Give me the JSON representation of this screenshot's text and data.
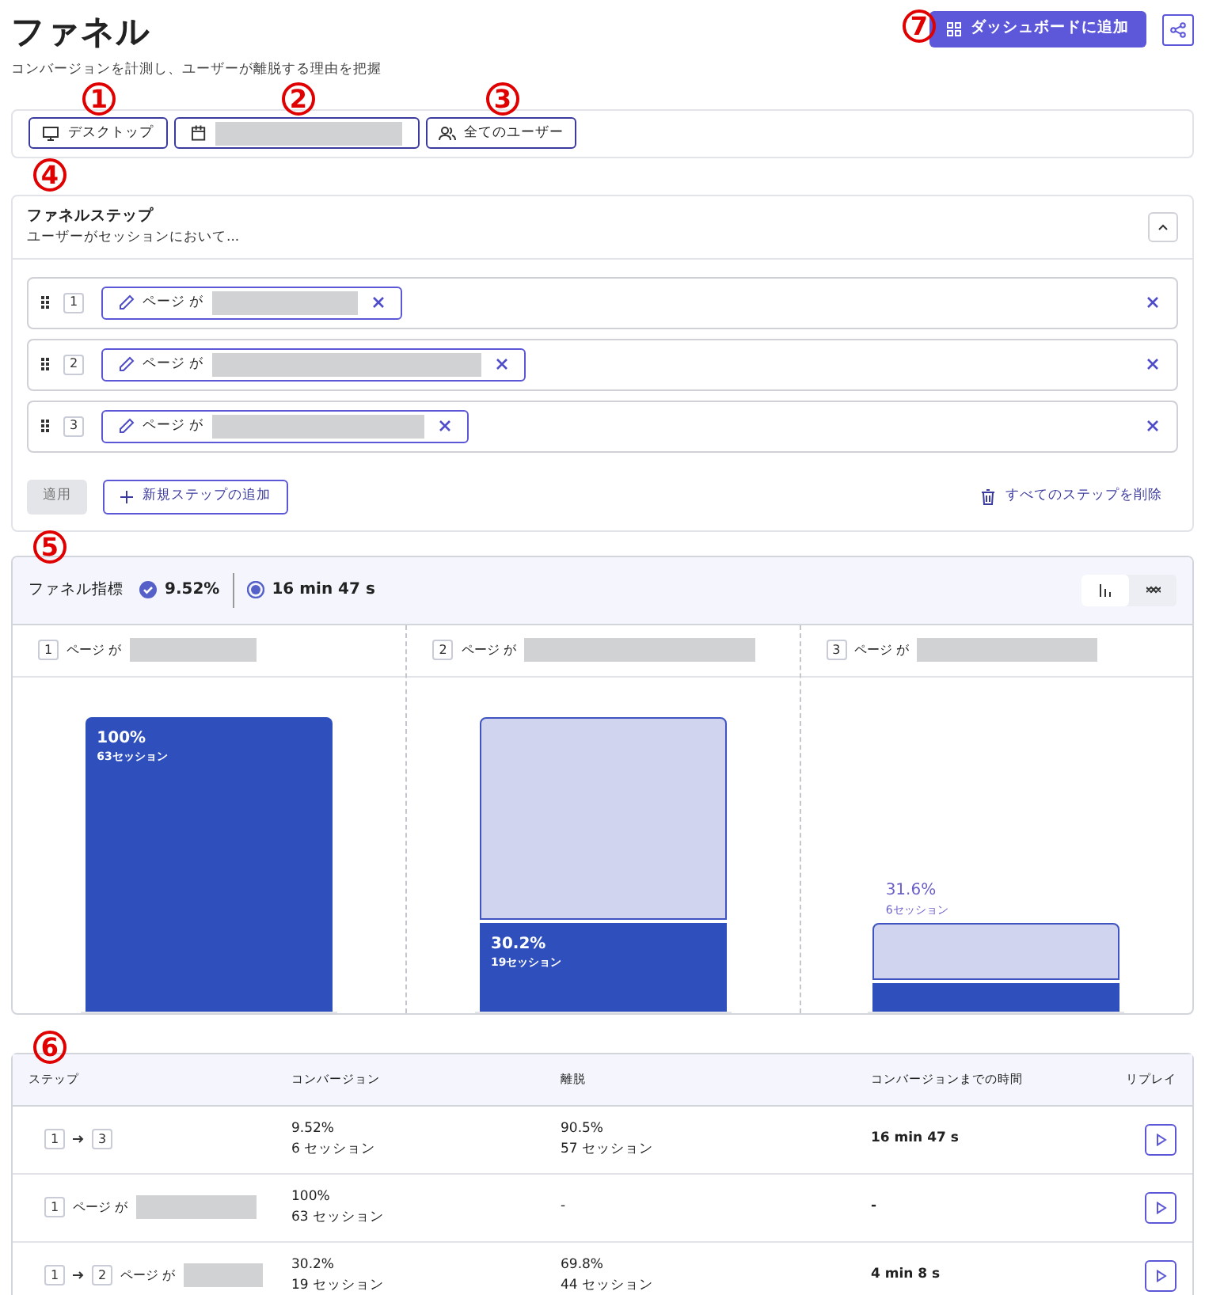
{
  "header": {
    "title": "ファネル",
    "subtitle": "コンバージョンを計測し、ユーザーが離脱する理由を把握",
    "add_button": "ダッシュボードに追加"
  },
  "filters": {
    "device": "デスクトップ",
    "users": "全てのユーザー"
  },
  "funnel_steps": {
    "title": "ファネルステップ",
    "subtitle": "ユーザーがセッションにおいて...",
    "expanded": true,
    "steps": [
      {
        "number": "1",
        "label": "ページ が"
      },
      {
        "number": "2",
        "label": "ページ が"
      },
      {
        "number": "3",
        "label": "ページ が"
      }
    ],
    "apply_button": "適用",
    "add_step_button": "新規ステップの追加",
    "delete_all_button": "すべてのステップを削除"
  },
  "metrics": {
    "title": "ファネル指標",
    "conversion": "9.52%",
    "time": "16 min 47 s",
    "views": [
      {
        "kind": "bars",
        "selected": true
      },
      {
        "kind": "trend",
        "selected": false
      }
    ],
    "columns": [
      {
        "number": "1",
        "label": "ページ が",
        "percent": "100%",
        "sessions": "63セッション",
        "level": 1
      },
      {
        "number": "2",
        "label": "ページ が",
        "percent": "30.2%",
        "sessions": "19セッション",
        "level": 0.302
      },
      {
        "number": "3",
        "label": "ページ が",
        "percent": "31.6%",
        "sessions": "6セッション",
        "level": 0.0952
      }
    ]
  },
  "table": {
    "columns": [
      "ステップ",
      "コンバージョン",
      "離脱",
      "コンバージョンまでの時間",
      "リプレイ"
    ],
    "rows": [
      {
        "steps": [
          "1",
          "3"
        ],
        "conversion": "9.52%",
        "conversion_sessions": "6 セッション",
        "dropoff": "90.5%",
        "dropoff_sessions": "57 セッション",
        "time": "16 min 47 s"
      },
      {
        "steps": [
          "1"
        ],
        "label": "ページ が",
        "conversion": "100%",
        "conversion_sessions": "63 セッション",
        "dropoff": "-",
        "time": "-"
      },
      {
        "steps": [
          "1",
          "2"
        ],
        "label": "ページ が",
        "conversion": "30.2%",
        "conversion_sessions": "19 セッション",
        "dropoff": "69.8%",
        "dropoff_sessions": "44 セッション",
        "time": "4 min 8 s"
      }
    ]
  },
  "annotations": [
    "1",
    "2",
    "3",
    "4",
    "5",
    "6",
    "7"
  ]
}
